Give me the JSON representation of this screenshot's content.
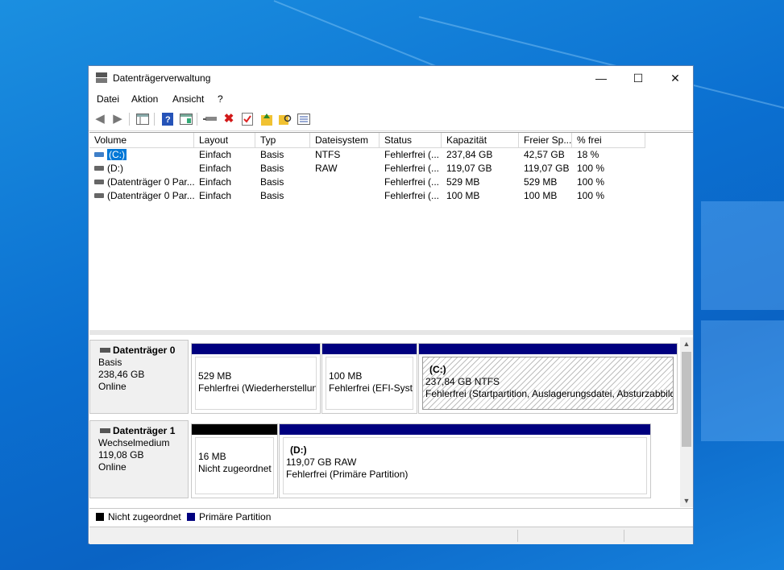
{
  "window": {
    "title": "Datenträgerverwaltung",
    "controls": {
      "minimize": "—",
      "maximize": "☐",
      "close": "✕"
    }
  },
  "menu": [
    "Datei",
    "Aktion",
    "Ansicht",
    "?"
  ],
  "toolbar": {
    "icons": [
      "back-icon",
      "forward-icon",
      "console-tree-icon",
      "help-icon",
      "view-icon",
      "connect-icon",
      "delete-icon",
      "properties-icon",
      "move-up-icon",
      "find-icon",
      "list-icon"
    ]
  },
  "table": {
    "columns": [
      "Volume",
      "Layout",
      "Typ",
      "Dateisystem",
      "Status",
      "Kapazität",
      "Freier Sp...",
      "% frei"
    ],
    "rows": [
      {
        "volume": "(C:)",
        "layout": "Einfach",
        "typ": "Basis",
        "fs": "NTFS",
        "status": "Fehlerfrei (...",
        "capacity": "237,84 GB",
        "free": "42,57 GB",
        "pct": "18 %"
      },
      {
        "volume": "(D:)",
        "layout": "Einfach",
        "typ": "Basis",
        "fs": "RAW",
        "status": "Fehlerfrei (...",
        "capacity": "119,07 GB",
        "free": "119,07 GB",
        "pct": "100 %"
      },
      {
        "volume": "(Datenträger 0 Par...",
        "layout": "Einfach",
        "typ": "Basis",
        "fs": "",
        "status": "Fehlerfrei (...",
        "capacity": "529 MB",
        "free": "529 MB",
        "pct": "100 %"
      },
      {
        "volume": "(Datenträger 0 Par...",
        "layout": "Einfach",
        "typ": "Basis",
        "fs": "",
        "status": "Fehlerfrei (...",
        "capacity": "100 MB",
        "free": "100 MB",
        "pct": "100 %"
      }
    ]
  },
  "disks": [
    {
      "name": "Datenträger 0",
      "type": "Basis",
      "size": "238,46 GB",
      "state": "Online",
      "partitions": [
        {
          "title": "",
          "line1": "529 MB",
          "line2": "Fehlerfrei (Wiederherstellun"
        },
        {
          "title": "",
          "line1": "100 MB",
          "line2": "Fehlerfrei (EFI-Syste"
        },
        {
          "title": "(C:)",
          "line1": "237,84 GB NTFS",
          "line2": "Fehlerfrei (Startpartition, Auslagerungsdatei, Absturzabbild"
        }
      ]
    },
    {
      "name": "Datenträger 1",
      "type": "Wechselmedium",
      "size": "119,08 GB",
      "state": "Online",
      "partitions": [
        {
          "title": "",
          "line1": "16 MB",
          "line2": "Nicht zugeordnet"
        },
        {
          "title": "(D:)",
          "line1": "119,07 GB RAW",
          "line2": "Fehlerfrei (Primäre Partition)"
        }
      ]
    }
  ],
  "legend": [
    {
      "label": "Nicht zugeordnet",
      "color": "#000000"
    },
    {
      "label": "Primäre Partition",
      "color": "#00007f"
    }
  ]
}
